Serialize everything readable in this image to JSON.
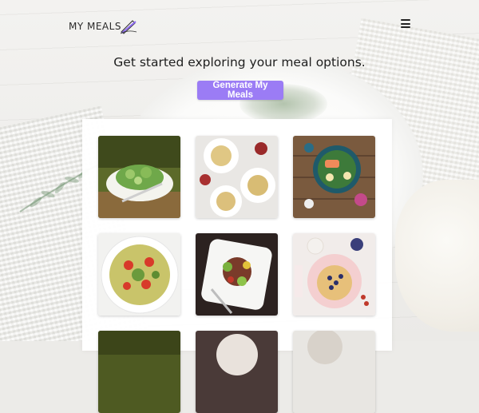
{
  "brand": {
    "name": "MY MEALS"
  },
  "header": {
    "menu_icon": "hamburger-icon"
  },
  "hero": {
    "headline": "Get started exploring your meal options.",
    "cta_label": "Generate My Meals",
    "cta_color": "#9b7cf5"
  },
  "meals": [
    {
      "image": "green-salad-bowl"
    },
    {
      "image": "pasta-plates-table"
    },
    {
      "image": "salmon-salad-bowl"
    },
    {
      "image": "bowtie-pasta-salad"
    },
    {
      "image": "steak-vegetable-plate"
    },
    {
      "image": "blueberry-pancakes"
    },
    {
      "image": "meal-7"
    },
    {
      "image": "meal-8"
    },
    {
      "image": "meal-9"
    }
  ]
}
